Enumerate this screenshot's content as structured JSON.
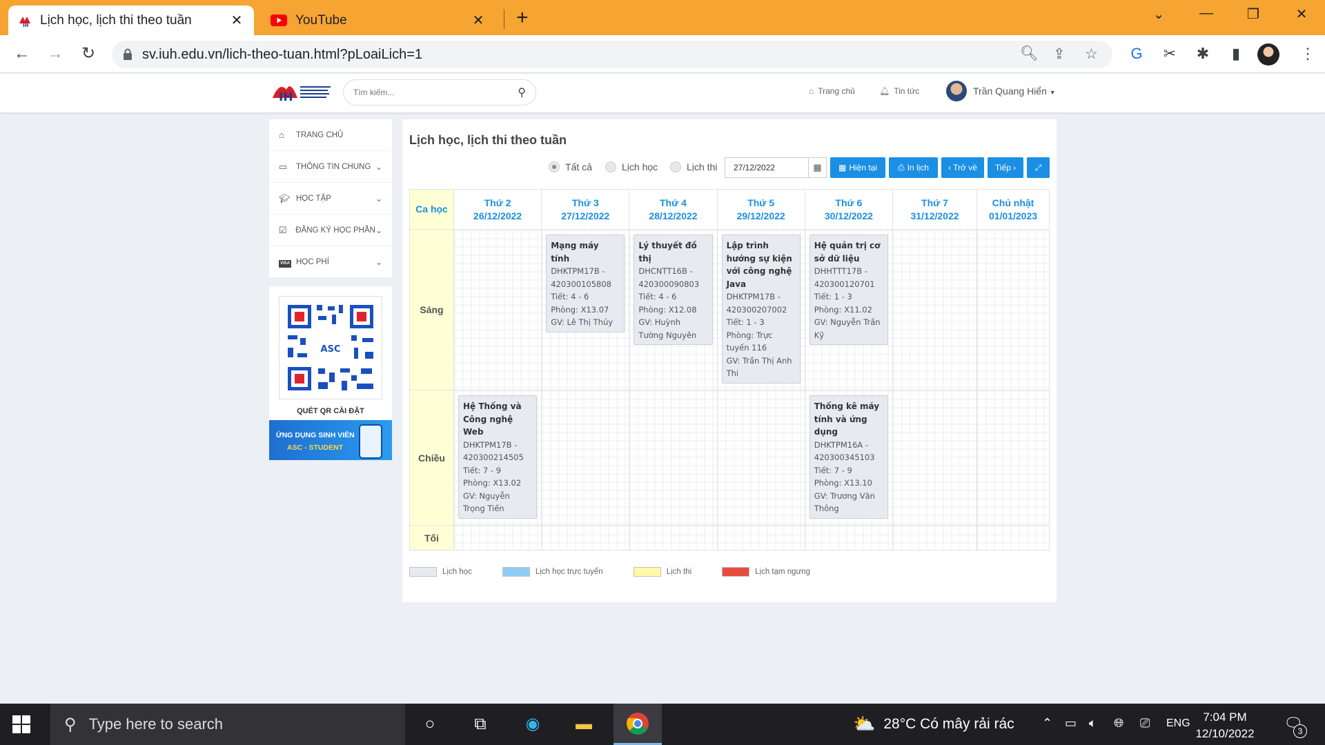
{
  "browser": {
    "tabs": [
      {
        "title": "Lịch học, lịch thi theo tuần",
        "active": true
      },
      {
        "title": "YouTube",
        "active": false
      }
    ],
    "url": "sv.iuh.edu.vn/lich-theo-tuan.html?pLoaiLich=1"
  },
  "header": {
    "search_placeholder": "Tìm kiếm...",
    "home_link": "Trang chủ",
    "news_link": "Tin tức",
    "user_name": "Trần Quang Hiển"
  },
  "sidebar": {
    "items": [
      {
        "label": "TRANG CHỦ"
      },
      {
        "label": "THÔNG TIN CHUNG"
      },
      {
        "label": "HỌC TẬP"
      },
      {
        "label": "ĐĂNG KÝ HỌC PHẦN"
      },
      {
        "label": "HỌC PHÍ"
      }
    ],
    "qr_caption": "QUÉT QR CÀI ĐẶT",
    "banner_line1": "ỨNG DỤNG SINH VIÊN",
    "banner_line2": "ASC - STUDENT"
  },
  "main": {
    "title": "Lịch học, lịch thi theo tuần",
    "filters": {
      "all": "Tất cả",
      "study": "Lịch học",
      "exam": "Lịch thi"
    },
    "date_value": "27/12/2022",
    "buttons": {
      "current": "Hiện tại",
      "print": "In lịch",
      "back": "‹ Trở về",
      "next": "Tiếp ›"
    },
    "table": {
      "corner": "Ca học",
      "days": [
        {
          "day": "Thứ 2",
          "date": "26/12/2022"
        },
        {
          "day": "Thứ 3",
          "date": "27/12/2022"
        },
        {
          "day": "Thứ 4",
          "date": "28/12/2022"
        },
        {
          "day": "Thứ 5",
          "date": "29/12/2022"
        },
        {
          "day": "Thứ 6",
          "date": "30/12/2022"
        },
        {
          "day": "Thứ 7",
          "date": "31/12/2022"
        },
        {
          "day": "Chủ nhật",
          "date": "01/01/2023"
        }
      ],
      "sessions": [
        "Sáng",
        "Chiều",
        "Tối"
      ],
      "classes": {
        "sang_thu3": {
          "name": "Mạng máy tính",
          "code": "DHKTPM17B - 420300105808",
          "period": "Tiết: 4 - 6",
          "room": "Phòng: X13.07",
          "teacher": "GV: Lê Thị Thủy"
        },
        "sang_thu4": {
          "name": "Lý thuyết đồ thị",
          "code": "DHCNTT16B - 420300090803",
          "period": "Tiết: 4 - 6",
          "room": "Phòng: X12.08",
          "teacher": "GV: Huỳnh Tường Nguyên"
        },
        "sang_thu5": {
          "name": "Lập trình hướng sự kiện với công nghệ Java",
          "code": "DHKTPM17B - 420300207002",
          "period": "Tiết: 1 - 3",
          "room": "Phòng: Trực tuyến 116",
          "teacher": "GV: Trần Thị Anh Thi"
        },
        "sang_thu6": {
          "name": "Hệ quản trị cơ sở dữ liệu",
          "code": "DHHTTT17B - 420300120701",
          "period": "Tiết: 1 - 3",
          "room": "Phòng: X11.02",
          "teacher": "GV: Nguyễn Trần Kỹ"
        },
        "chieu_thu2": {
          "name": "Hệ Thống và Công nghệ Web",
          "code": "DHKTPM17B - 420300214505",
          "period": "Tiết: 7 - 9",
          "room": "Phòng: X13.02",
          "teacher": "GV: Nguyễn Trọng Tiến"
        },
        "chieu_thu6": {
          "name": "Thống kê máy tính và ứng dụng",
          "code": "DHKTPM16A - 420300345103",
          "period": "Tiết: 7 - 9",
          "room": "Phòng: X13.10",
          "teacher": "GV: Trương Văn Thông"
        }
      }
    },
    "legend": [
      {
        "label": "Lịch học",
        "color": "#e7ebf1"
      },
      {
        "label": "Lịch học trực tuyến",
        "color": "#90cdf4"
      },
      {
        "label": "Lịch thi",
        "color": "#fff9a8"
      },
      {
        "label": "Lịch tạm ngưng",
        "color": "#e74c3c"
      }
    ]
  },
  "taskbar": {
    "search_placeholder": "Type here to search",
    "weather": "28°C  Có mây rải rác",
    "language": "ENG",
    "time": "7:04 PM",
    "date": "12/10/2022",
    "notification_count": "3"
  },
  "colors": {
    "accent": "#1a8fe3",
    "tabbar": "#f6a432",
    "session_bg": "#ffffd6"
  }
}
